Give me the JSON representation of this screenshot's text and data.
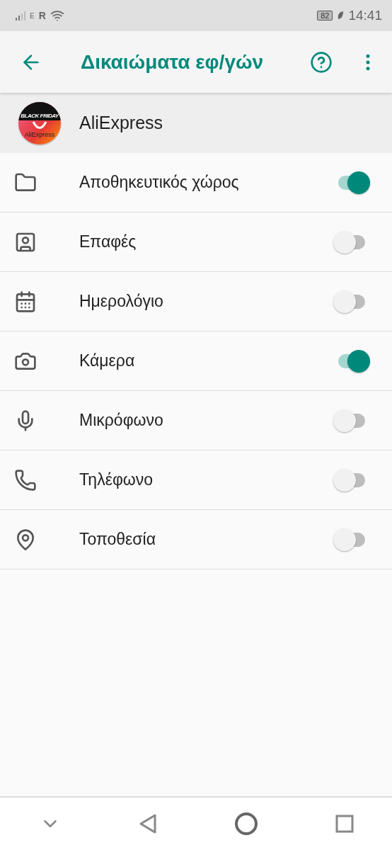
{
  "status_bar": {
    "network": "E",
    "roaming": "R",
    "battery": "82",
    "time": "14:41"
  },
  "app_bar": {
    "title": "Δικαιώματα εφ/γών"
  },
  "app": {
    "name": "AliExpress",
    "icon_banner": "BLACK FRIDAY",
    "icon_label": "AliExpress"
  },
  "permissions": [
    {
      "label": "Αποθηκευτικός χώρος",
      "on": true
    },
    {
      "label": "Επαφές",
      "on": false
    },
    {
      "label": "Ημερολόγιο",
      "on": false
    },
    {
      "label": "Κάμερα",
      "on": true
    },
    {
      "label": "Μικρόφωνο",
      "on": false
    },
    {
      "label": "Τηλέφωνο",
      "on": false
    },
    {
      "label": "Τοποθεσία",
      "on": false
    }
  ]
}
